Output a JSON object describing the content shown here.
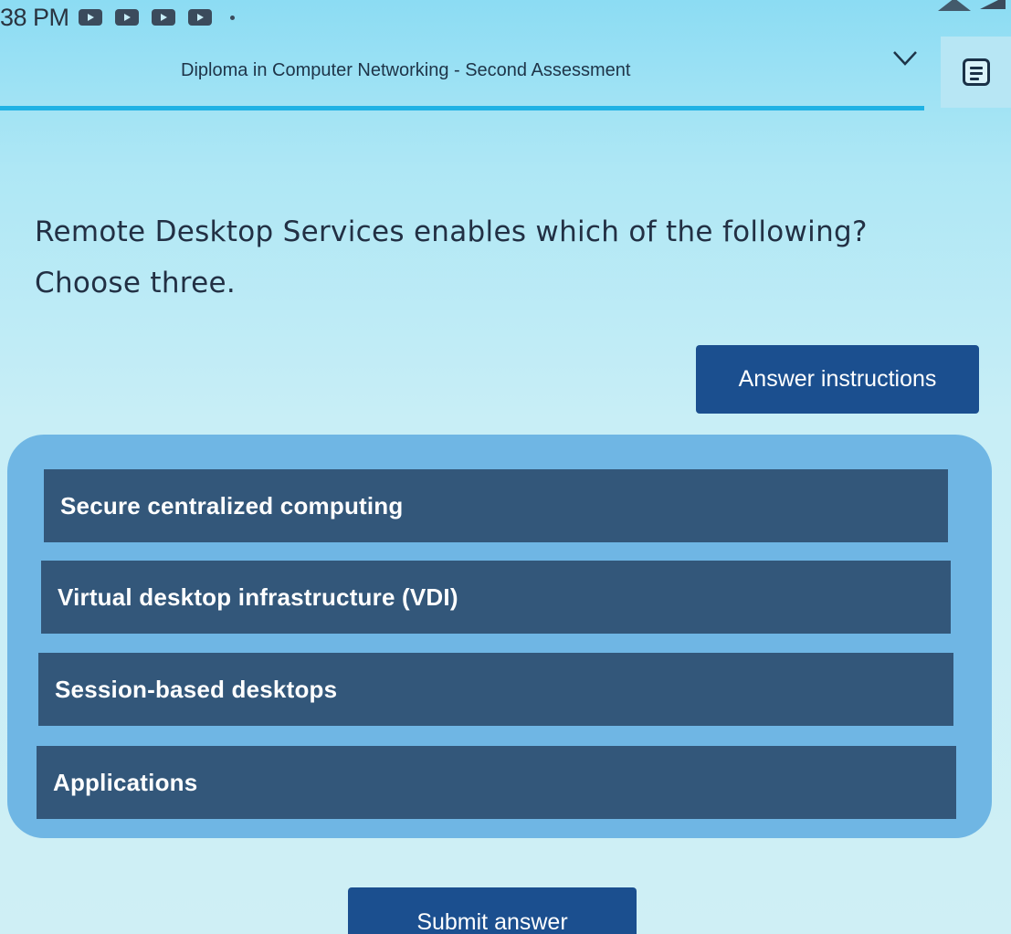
{
  "status_bar": {
    "time": "38 PM"
  },
  "header": {
    "title": "Diploma in Computer Networking - Second Assessment"
  },
  "question": {
    "line1": "Remote Desktop Services enables which of the following?",
    "line2": "Choose three."
  },
  "answer_instructions_label": "Answer instructions",
  "options": [
    {
      "label": "Secure centralized computing"
    },
    {
      "label": "Virtual desktop infrastructure (VDI)"
    },
    {
      "label": "Session-based desktops"
    },
    {
      "label": "Applications"
    }
  ],
  "submit_label": "Submit answer",
  "colors": {
    "background": "#c8eef6",
    "accent_underline": "#1fb2e4",
    "button_primary": "#1b4f8f",
    "option_bg": "#33577a",
    "panel_bg": "#6fb6e4"
  },
  "icons": [
    "play-notification-icon",
    "wifi-icon",
    "signal-icon",
    "chevron-down-icon",
    "notes-icon"
  ]
}
